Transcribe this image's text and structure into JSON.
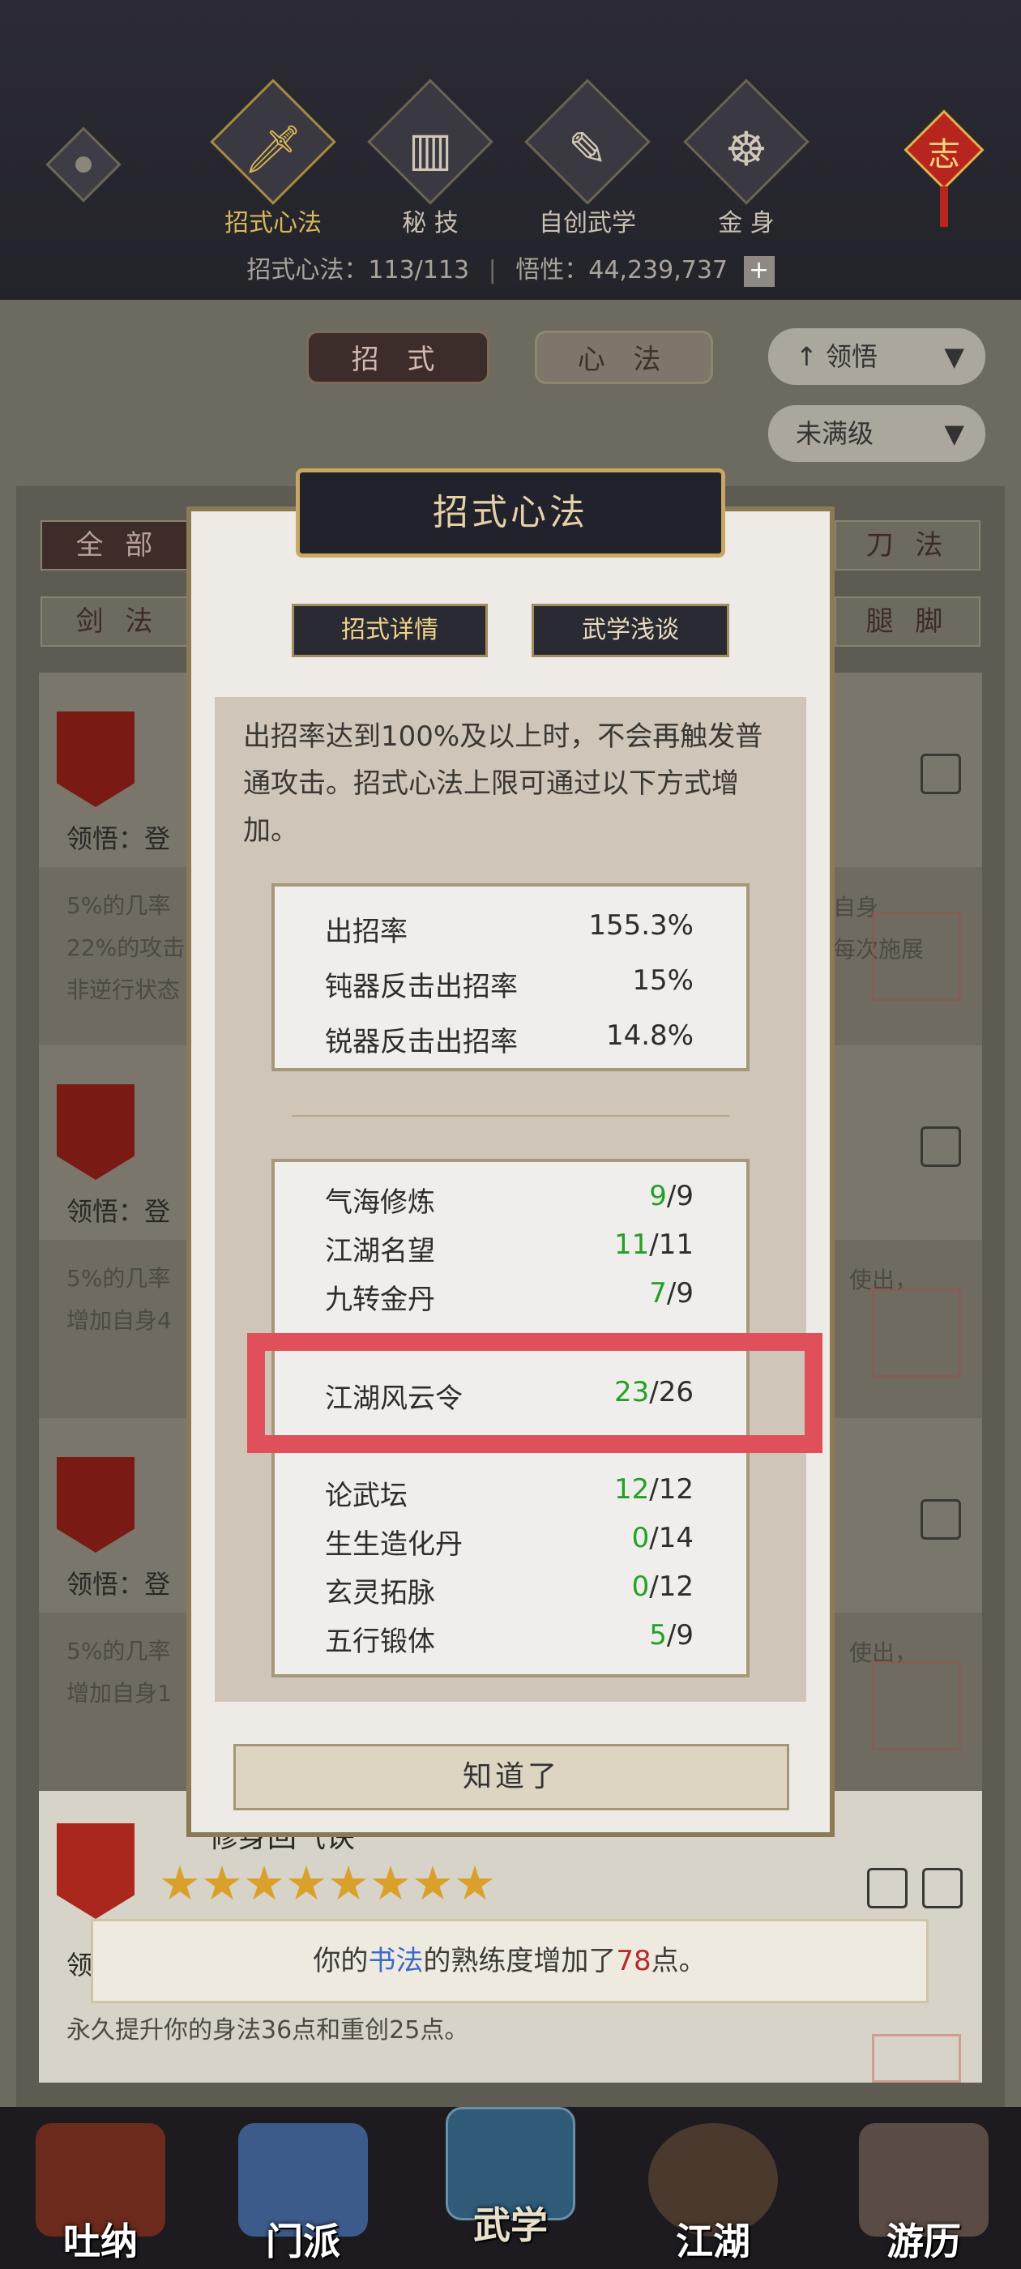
{
  "header": {
    "tabs": [
      {
        "label": "招式心法",
        "icon": "sword-icon",
        "active": true
      },
      {
        "label": "秘 技",
        "icon": "book-icon",
        "active": false
      },
      {
        "label": "自创武学",
        "icon": "scroll-icon",
        "active": false
      },
      {
        "label": "金 身",
        "icon": "meditation-icon",
        "active": false
      }
    ],
    "eye_icon": "eye-icon",
    "ornament_icon": "chinese-knot-icon",
    "ornament_char": "志",
    "stats_left": "招式心法：113/113",
    "stats_right": "悟性：44,239,737",
    "plus": "+"
  },
  "toolbar": {
    "tab_zhaoshi": "招 式",
    "tab_xinfa": "心 法",
    "sort_label": "领悟",
    "filter_label": "未满级"
  },
  "filters": {
    "all": "全 部",
    "sword": "剑 法",
    "blade": "刀 法",
    "leg": "腿 脚"
  },
  "cards": [
    {
      "lingwu": "领悟：登",
      "desc_1": "5%的几率",
      "desc_2": "22%的攻击",
      "desc_3": "非逆行状态",
      "right_1": "自身",
      "right_2": "每次施展"
    },
    {
      "lingwu": "领悟：登",
      "desc_1": "5%的几率",
      "desc_2": "增加自身4",
      "right_1": "使出，"
    },
    {
      "lingwu": "领悟：登",
      "desc_1": "5%的几率",
      "desc_2": "增加自身1",
      "right_1": "使出，"
    },
    {
      "lingwu": "领",
      "desc_1": "永久提升你的身法36点和重创25点。",
      "title_partial": "修身回气诀"
    }
  ],
  "dialog": {
    "title": "招式心法",
    "tab_detail": "招式详情",
    "tab_talk": "武学浅谈",
    "intro": "出招率达到100%及以上时，不会再触发普通攻击。招式心法上限可通过以下方式增加。",
    "rates": [
      {
        "label": "出招率",
        "value": "155.3%"
      },
      {
        "label": "钝器反击出招率",
        "value": "15%"
      },
      {
        "label": "锐器反击出招率",
        "value": "14.8%"
      }
    ],
    "sources": [
      {
        "label": "气海修炼",
        "cur": "9",
        "max": "/9"
      },
      {
        "label": "江湖名望",
        "cur": "11",
        "max": "/11"
      },
      {
        "label": "九转金丹",
        "cur": "7",
        "max": "/9"
      },
      {
        "label": "江湖风云令",
        "cur": "23",
        "max": "/26"
      },
      {
        "label": "论武坛",
        "cur": "12",
        "max": "/12"
      },
      {
        "label": "生生造化丹",
        "cur": "0",
        "max": "/14"
      },
      {
        "label": "玄灵拓脉",
        "cur": "0",
        "max": "/12"
      },
      {
        "label": "五行锻体",
        "cur": "5",
        "max": "/9"
      }
    ],
    "ok": "知道了"
  },
  "toast": {
    "prefix": "你的",
    "skill": "书法",
    "middle": "的熟练度增加了",
    "amount": "78",
    "suffix": "点。"
  },
  "nav": [
    {
      "label": "吐纳"
    },
    {
      "label": "门派"
    },
    {
      "label": "武学"
    },
    {
      "label": "江湖"
    },
    {
      "label": "游历"
    }
  ],
  "colors": {
    "highlight": "#e0505a",
    "accent_gold": "#c8a760",
    "green": "#24a024"
  }
}
